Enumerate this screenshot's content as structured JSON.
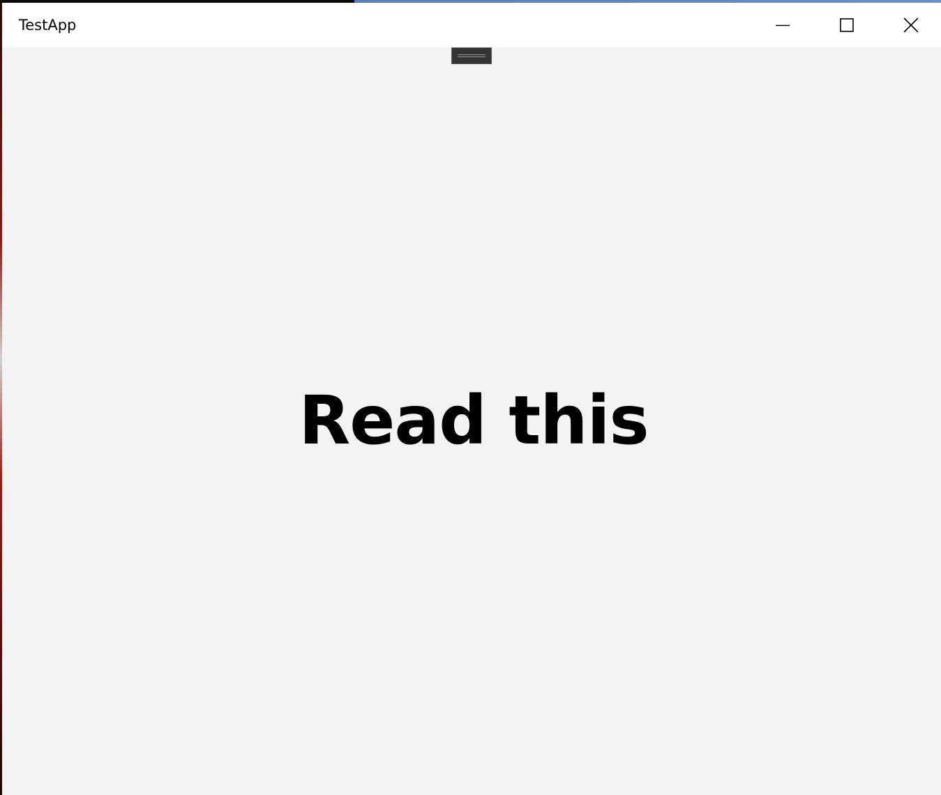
{
  "window": {
    "title": "TestApp",
    "background_color": "#f3f3f3",
    "titlebar_color": "#ffffff"
  },
  "caption_buttons": {
    "minimize_icon": "minimize-icon",
    "maximize_icon": "maximize-icon",
    "close_icon": "close-icon"
  },
  "drag_handle": {
    "icon": "grip-lines-icon",
    "color": "#333333"
  },
  "main": {
    "text": "Read this",
    "text_color": "#000000"
  }
}
